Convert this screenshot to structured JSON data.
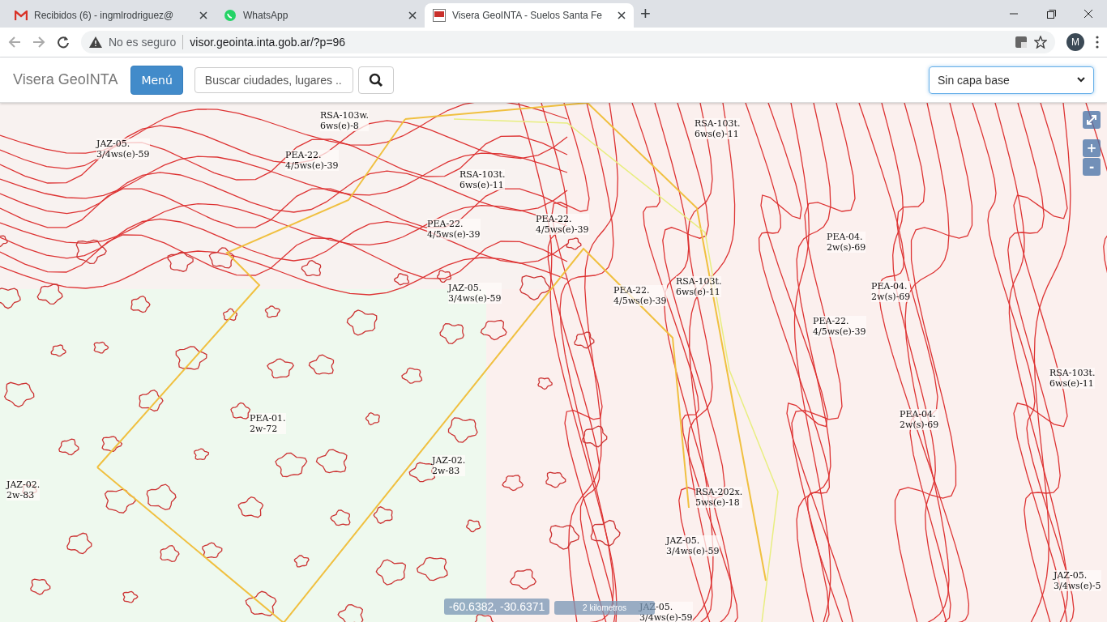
{
  "browser": {
    "tabs": [
      {
        "kind": "mail",
        "title": "Recibidos (6) - ingmlrodriguez@",
        "selected": false
      },
      {
        "kind": "chat",
        "title": "WhatsApp",
        "selected": false
      },
      {
        "kind": "site",
        "title": "Visera GeoINTA - Suelos Santa Fe",
        "selected": true
      }
    ],
    "new_tab": "+",
    "security": "No es seguro",
    "url": "visor.geointa.inta.gob.ar/?p=96",
    "profile": "M"
  },
  "app": {
    "brand": "Visera GeoINTA",
    "menu_button": "Menú",
    "search": {
      "placeholder": "Buscar ciudades, lugares ..."
    },
    "base_layer": "Sin capa base"
  },
  "map": {
    "labels": [
      {
        "lines": [
          "RSA-103w.",
          "6ws(e)-8"
        ]
      },
      {
        "lines": [
          "RSA-103t.",
          "6ws(e)-11"
        ]
      },
      {
        "lines": [
          "JAZ-05.",
          "3/4ws(e)-59"
        ]
      },
      {
        "lines": [
          "PEA-22.",
          "4/5ws(e)-39"
        ]
      },
      {
        "lines": [
          "RSA-103t.",
          "6ws(e)-11"
        ]
      },
      {
        "lines": [
          "PEA-22.",
          "4/5ws(e)-39"
        ]
      },
      {
        "lines": [
          "PEA-22.",
          "4/5ws(e)-39"
        ]
      },
      {
        "lines": [
          "PEA-04.",
          "2w(s)-69"
        ]
      },
      {
        "lines": [
          "JAZ-05.",
          "3/4ws(e)-59"
        ]
      },
      {
        "lines": [
          "PEA-22.",
          "4/5ws(e)-39"
        ]
      },
      {
        "lines": [
          "RSA-103t.",
          "6ws(e)-11"
        ]
      },
      {
        "lines": [
          "PEA-04.",
          "2w(s)-69"
        ]
      },
      {
        "lines": [
          "PEA-22.",
          "4/5ws(e)-39"
        ]
      },
      {
        "lines": [
          "RSA-103t.",
          "6ws(e)-11"
        ]
      },
      {
        "lines": [
          "PEA-01.",
          "2w-72"
        ]
      },
      {
        "lines": [
          "PEA-04.",
          "2w(s)-69"
        ]
      },
      {
        "lines": [
          "JAZ-02.",
          "2w-83"
        ]
      },
      {
        "lines": [
          "JAZ-02.",
          "2w-83"
        ]
      },
      {
        "lines": [
          "RSA-202x.",
          "5ws(e)-18"
        ]
      },
      {
        "lines": [
          "JAZ-05.",
          "3/4ws(e)-59"
        ]
      },
      {
        "lines": [
          "JAZ-05.",
          "3/4ws(e)-5"
        ]
      },
      {
        "lines": [
          "JAZ-05.",
          "3/4ws(e)-59"
        ]
      }
    ],
    "zoom_in": "+",
    "zoom_out": "-",
    "coordinates": "-60.6382, -30.6371",
    "scale": "2 kilometros"
  }
}
